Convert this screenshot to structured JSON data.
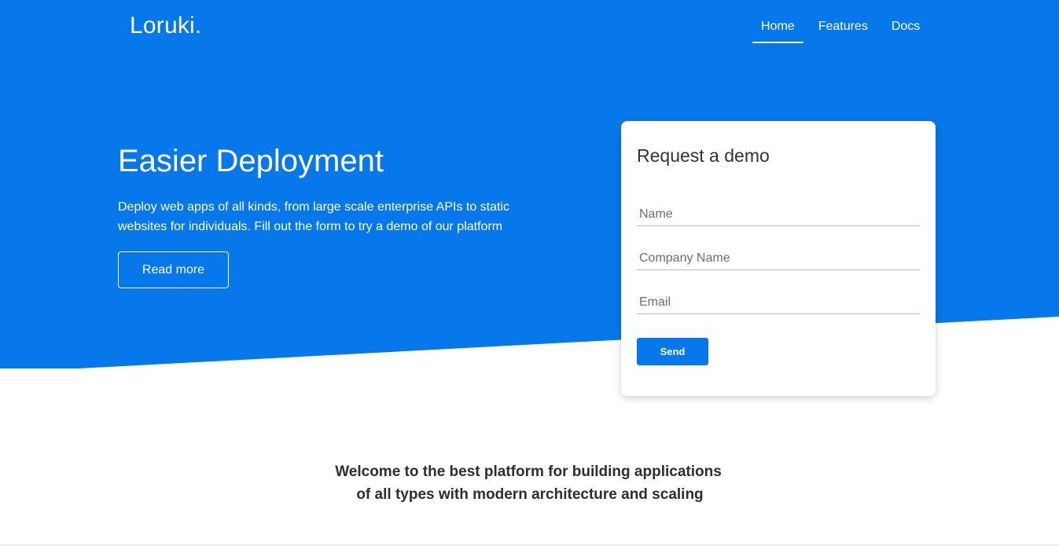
{
  "brand": {
    "logo": "Loruki."
  },
  "nav": {
    "items": [
      {
        "label": "Home",
        "active": true
      },
      {
        "label": "Features",
        "active": false
      },
      {
        "label": "Docs",
        "active": false
      }
    ]
  },
  "hero": {
    "title": "Easier Deployment",
    "text": "Deploy web apps of all kinds, from large scale enterprise APIs to static websites for individuals. Fill out the form to try a demo of our platform",
    "button_label": "Read more"
  },
  "demo_form": {
    "title": "Request a demo",
    "fields": [
      {
        "placeholder": "Name",
        "value": ""
      },
      {
        "placeholder": "Company Name",
        "value": ""
      },
      {
        "placeholder": "Email",
        "value": ""
      }
    ],
    "submit_label": "Send"
  },
  "welcome": {
    "line1": "Welcome to the best platform for building applications",
    "line2": "of all types with modern architecture and scaling"
  },
  "colors": {
    "primary": "#0678eb",
    "white": "#ffffff",
    "heading_text": "#2e2e2e"
  }
}
